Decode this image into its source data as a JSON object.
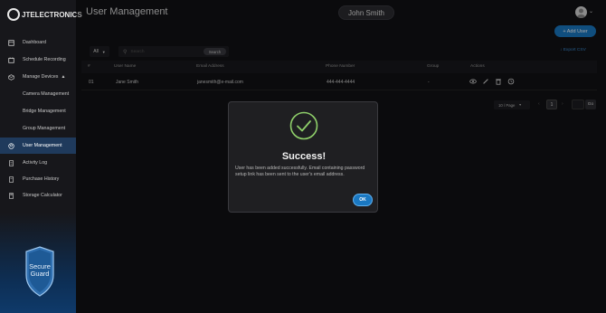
{
  "logo": {
    "text": "JTELECTRONICS"
  },
  "sidebar": {
    "items": [
      {
        "label": "Dashboard"
      },
      {
        "label": "Schedule Recording"
      },
      {
        "label": "Manage Devices"
      },
      {
        "label": "Camera Management"
      },
      {
        "label": "Bridge Management"
      },
      {
        "label": "Group Management"
      },
      {
        "label": "User Management"
      },
      {
        "label": "Activity Log"
      },
      {
        "label": "Purchase History"
      },
      {
        "label": "Storage Calculator"
      }
    ],
    "badge": {
      "line1": "Secure",
      "line2": "Guard"
    }
  },
  "header": {
    "title": "User Management",
    "user_name": "John Smith"
  },
  "toolbar": {
    "add_user": "+ Add User",
    "export": "↓ Export CSV",
    "filter_value": "All",
    "search_placeholder": "Search",
    "search_button": "Search"
  },
  "table": {
    "headers": [
      "#",
      "User Name",
      "Email Address",
      "Phone Number",
      "Group",
      "Actions"
    ],
    "rows": [
      {
        "num": "01",
        "name": "Jane Smith",
        "email": "janesmith@e-mail.com",
        "phone": "444-444-4444",
        "group": "-"
      }
    ]
  },
  "pagination": {
    "page_size": "10 / Page",
    "current_page": "1",
    "go": "Go"
  },
  "modal": {
    "title": "Success!",
    "message": "User has been added successfully. Email containing password setup link has been sent to the user's email address.",
    "ok": "OK"
  },
  "colors": {
    "accent": "#1a78c2",
    "success": "#8fcf6a",
    "background": "#111114"
  }
}
